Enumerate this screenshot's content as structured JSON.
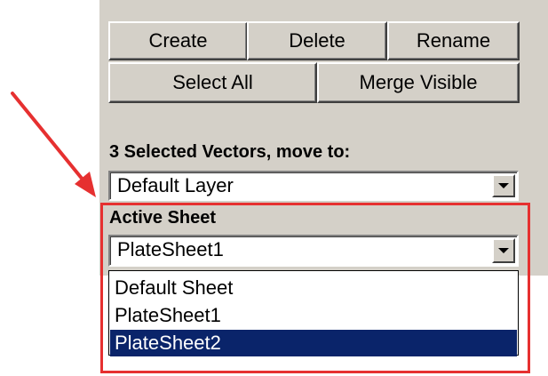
{
  "buttons": {
    "create": "Create",
    "delete": "Delete",
    "rename": "Rename",
    "select_all": "Select All",
    "merge_visible": "Merge Visible"
  },
  "move_to": {
    "label": "3 Selected Vectors, move to:",
    "value": "Default Layer"
  },
  "active_sheet": {
    "label": "Active Sheet",
    "value": "PlateSheet1",
    "options": [
      "Default Sheet",
      "PlateSheet1",
      "PlateSheet2"
    ],
    "highlighted_option": "PlateSheet2"
  },
  "colors": {
    "panel": "#d4d0c8",
    "selection": "#0a246a",
    "annotation": "#e63030"
  }
}
